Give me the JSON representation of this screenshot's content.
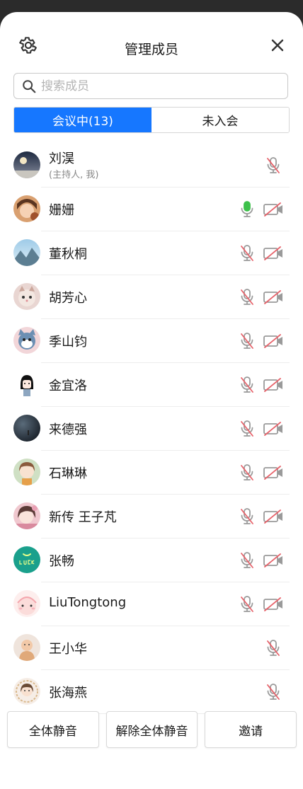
{
  "header": {
    "title": "管理成员"
  },
  "search": {
    "placeholder": "搜索成员"
  },
  "tabs": [
    {
      "label": "会议中(13)",
      "active": true
    },
    {
      "label": "未入会",
      "active": false
    }
  ],
  "members": [
    {
      "name": "刘淏",
      "sub": "(主持人, 我)",
      "mic": "muted",
      "camera": "none"
    },
    {
      "name": "姗姗",
      "mic": "on",
      "camera": "off"
    },
    {
      "name": "董秋桐",
      "mic": "muted",
      "camera": "off"
    },
    {
      "name": "胡芳心",
      "mic": "muted",
      "camera": "off"
    },
    {
      "name": "季山钧",
      "mic": "muted",
      "camera": "off"
    },
    {
      "name": "金宜洛",
      "mic": "muted",
      "camera": "off"
    },
    {
      "name": "来德强",
      "mic": "muted",
      "camera": "off"
    },
    {
      "name": "石琳琳",
      "mic": "muted",
      "camera": "off"
    },
    {
      "name": "新传 王子芃",
      "mic": "muted",
      "camera": "off"
    },
    {
      "name": "张畅",
      "mic": "muted",
      "camera": "off"
    },
    {
      "name": "LiuTongtong",
      "mic": "muted",
      "camera": "off"
    },
    {
      "name": "王小华",
      "mic": "muted",
      "camera": "none"
    },
    {
      "name": "张海燕",
      "mic": "muted",
      "camera": "none"
    }
  ],
  "footer": {
    "mute_all": "全体静音",
    "unmute_all": "解除全体静音",
    "invite": "邀请"
  },
  "colors": {
    "accent": "#1677ff",
    "mic_on": "#3cc04a",
    "muted_slash": "#e7636b",
    "icon_gray": "#9a9a9a"
  }
}
